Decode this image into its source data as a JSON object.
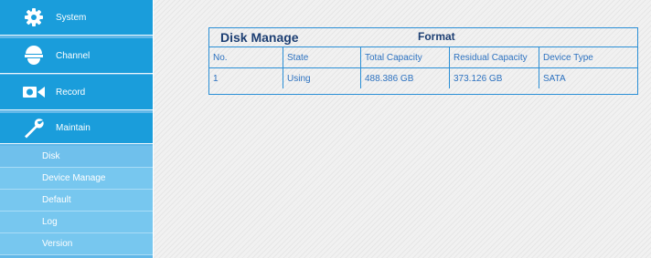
{
  "sidebar": {
    "items": [
      {
        "label": "System",
        "icon": "gear-icon"
      },
      {
        "label": "Channel",
        "icon": "camera-dome-icon"
      },
      {
        "label": "Record",
        "icon": "video-camera-icon"
      },
      {
        "label": "Maintain",
        "icon": "wrench-icon"
      }
    ],
    "submenu": [
      "Disk",
      "Device Manage",
      "Default",
      "Log",
      "Version"
    ],
    "active_submenu": "Disk"
  },
  "panel": {
    "title": "Disk Manage",
    "format_label": "Format"
  },
  "table": {
    "headers": [
      "No.",
      "State",
      "Total Capacity",
      "Residual Capacity",
      "Device Type"
    ],
    "rows": [
      [
        "1",
        "Using",
        "488.386 GB",
        "373.126 GB",
        "SATA"
      ]
    ]
  },
  "colors": {
    "nav_bg": "#1a9ddb",
    "submenu_bg": "#77c7ef",
    "table_border": "#2a8fd6",
    "table_text": "#2d72c0",
    "title_text": "#1d3f73"
  }
}
